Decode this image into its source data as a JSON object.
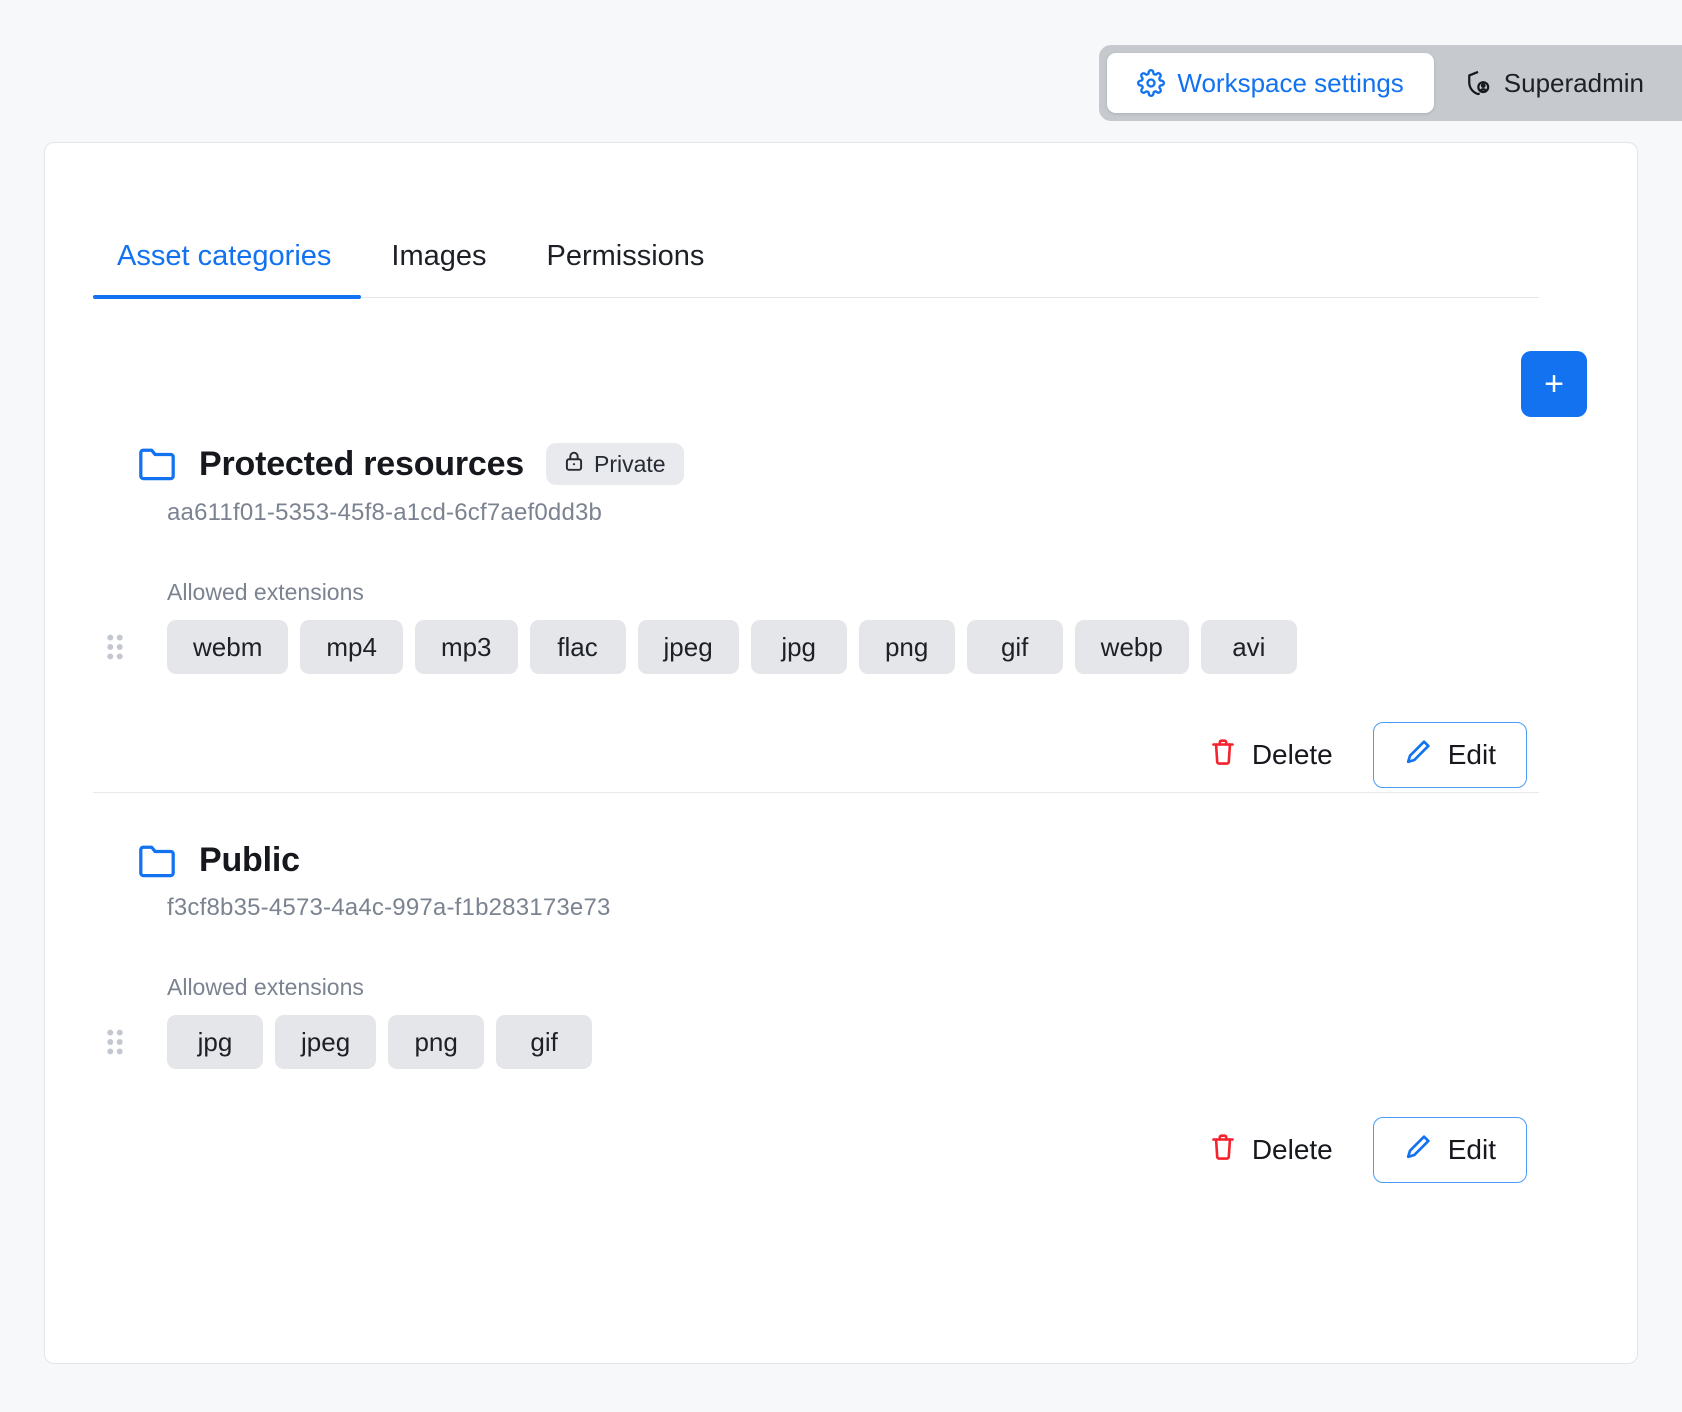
{
  "topbar": {
    "items": [
      {
        "label": "Workspace settings",
        "icon": "gear-icon",
        "active": true
      },
      {
        "label": "Superadmin",
        "icon": "shield-user-icon",
        "active": false
      }
    ]
  },
  "tabs": [
    {
      "label": "Asset categories",
      "active": true
    },
    {
      "label": "Images",
      "active": false
    },
    {
      "label": "Permissions",
      "active": false
    }
  ],
  "toolbar": {
    "add_label": "+"
  },
  "labels": {
    "allowed_extensions": "Allowed extensions",
    "delete": "Delete",
    "edit": "Edit"
  },
  "colors": {
    "accent": "#1272f0",
    "danger": "#f5222d",
    "chip_bg": "#e4e6ea",
    "muted_text": "#7b8391",
    "segment_bg": "#c6c9ce"
  },
  "categories": [
    {
      "name": "Protected resources",
      "badge": "Private",
      "badge_icon": "lock-icon",
      "uuid": "aa611f01-5353-45f8-a1cd-6cf7aef0dd3b",
      "extensions": [
        "webm",
        "mp4",
        "mp3",
        "flac",
        "jpeg",
        "jpg",
        "png",
        "gif",
        "webp",
        "avi"
      ]
    },
    {
      "name": "Public",
      "badge": null,
      "uuid": "f3cf8b35-4573-4a4c-997a-f1b283173e73",
      "extensions": [
        "jpg",
        "jpeg",
        "png",
        "gif"
      ]
    }
  ]
}
